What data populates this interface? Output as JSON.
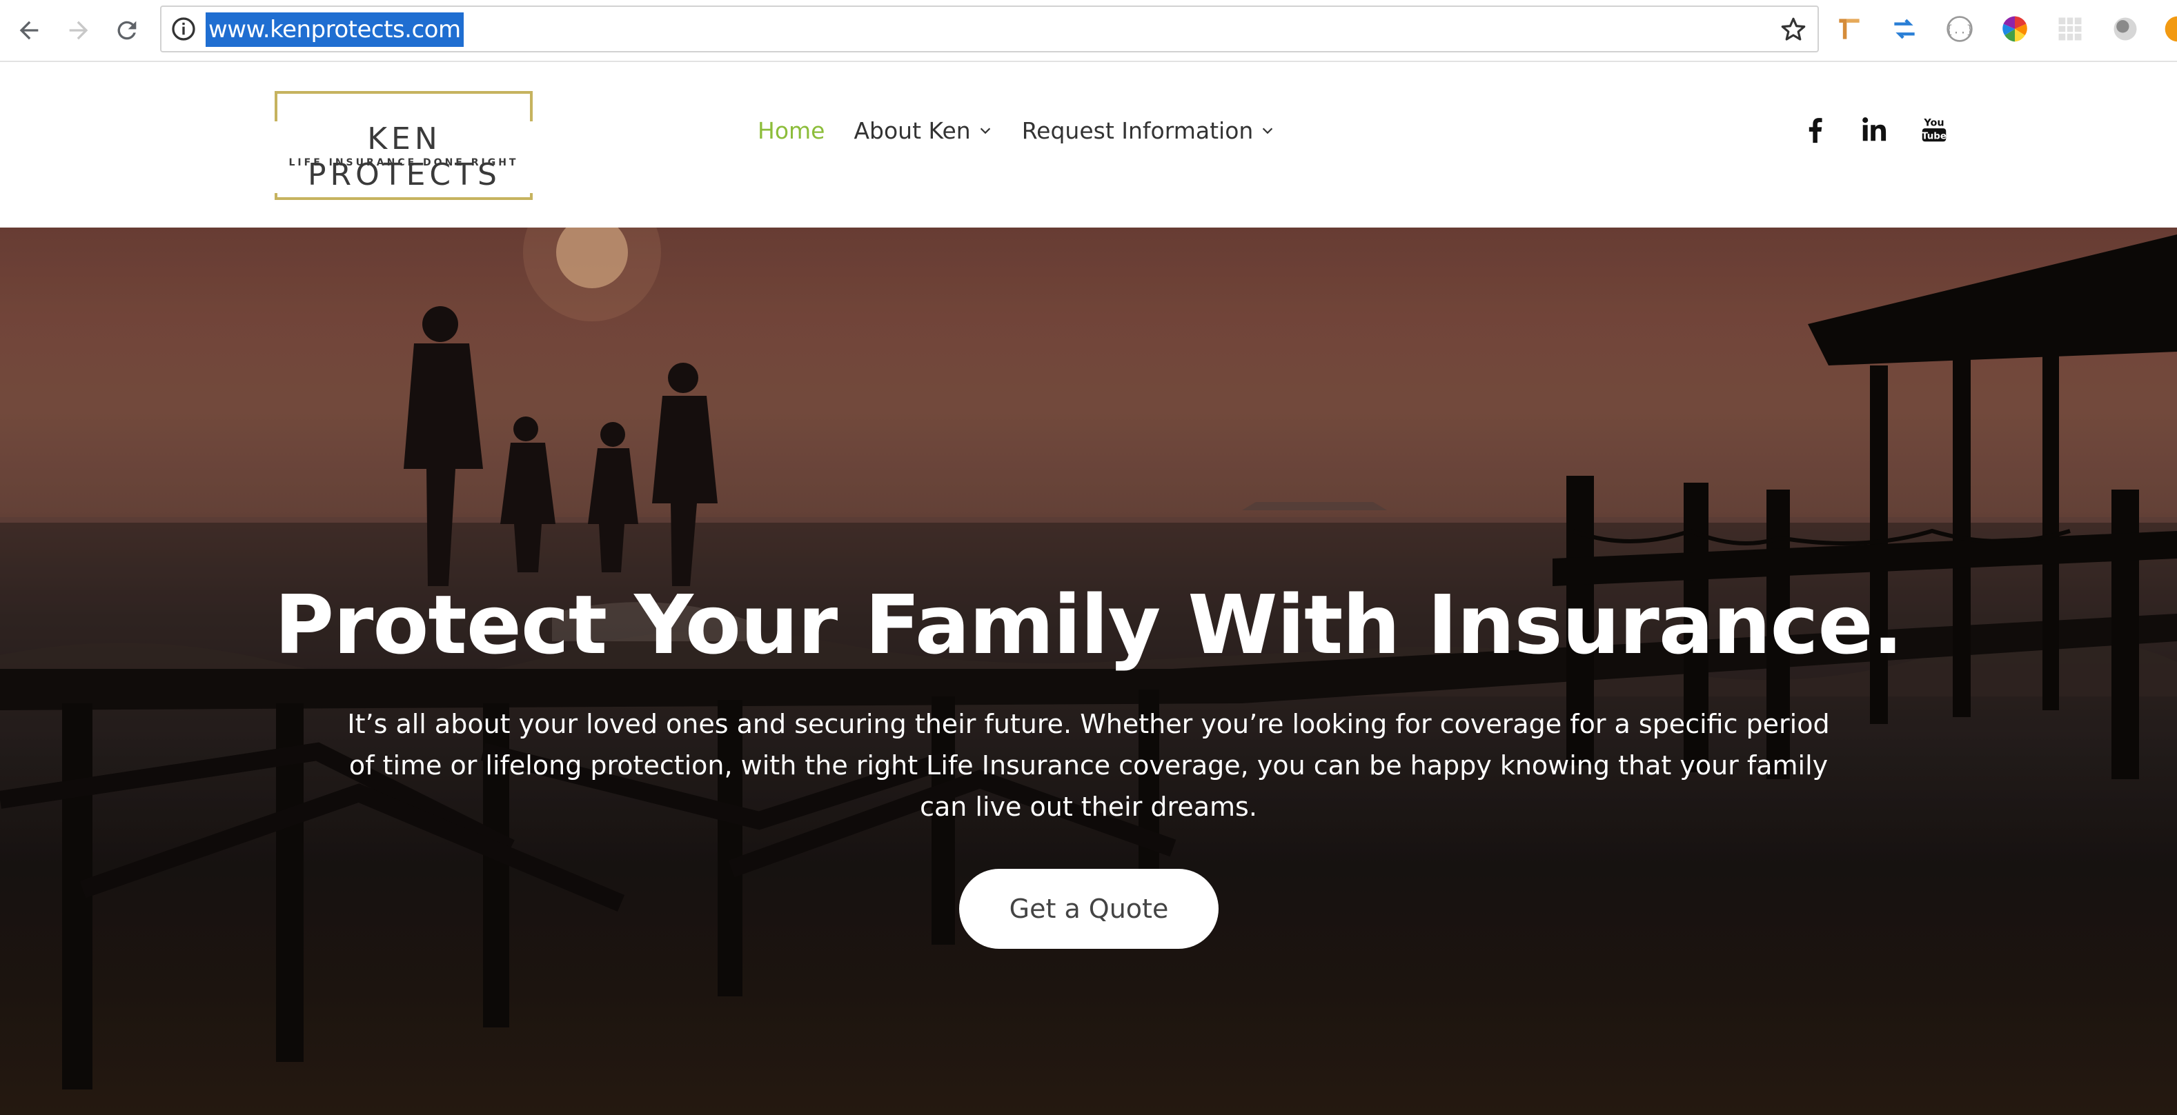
{
  "browser": {
    "url": "www.kenprotects.com",
    "icons": [
      "back-icon",
      "forward-icon",
      "reload-icon",
      "info-icon",
      "star-icon"
    ],
    "extensions": [
      "ruler-extension-icon",
      "swap-extension-icon",
      "json-extension-icon",
      "color-wheel-extension-icon",
      "grid-extension-icon",
      "circle-extension-icon",
      "orange-extension-icon"
    ]
  },
  "header": {
    "logo_title": "KEN PROTECTS",
    "logo_tagline": "LIFE INSURANCE DONE RIGHT",
    "nav": [
      {
        "label": "Home",
        "active": true
      },
      {
        "label": "About Ken",
        "dropdown": true
      },
      {
        "label": "Request Information",
        "dropdown": true
      }
    ],
    "social": [
      "facebook-icon",
      "linkedin-icon",
      "youtube-icon"
    ]
  },
  "hero": {
    "title": "Protect Your Family With Insurance.",
    "text": "It’s all about your loved ones and securing their future. Whether you’re looking for coverage for a specific period of time or lifelong protection, with the right Life Insurance coverage, you can be happy knowing that your family can live out their dreams.",
    "cta_label": "Get a Quote"
  },
  "colors": {
    "nav_active": "#8cbd3a",
    "logo_border": "#c6b35f",
    "url_highlight": "#1f6ed1"
  }
}
